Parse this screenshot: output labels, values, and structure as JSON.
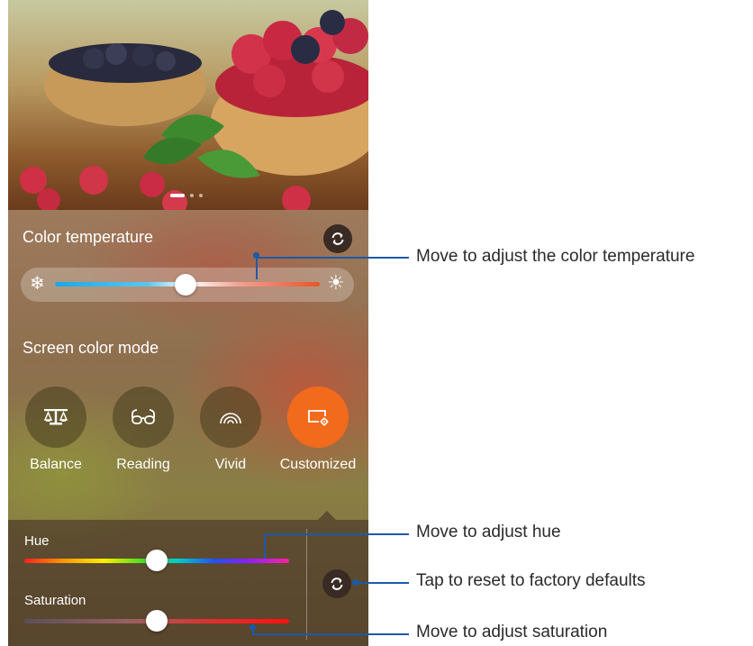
{
  "color_temperature": {
    "title": "Color temperature",
    "reset_icon": "refresh-icon",
    "cold_icon": "snowflake-icon",
    "warm_icon": "sun-icon",
    "value_fraction": 0.5
  },
  "screen_color_mode": {
    "title": "Screen color mode",
    "modes": [
      {
        "label": "Balance",
        "icon": "balance-icon",
        "selected": false
      },
      {
        "label": "Reading",
        "icon": "glasses-icon",
        "selected": false
      },
      {
        "label": "Vivid",
        "icon": "vivid-icon",
        "selected": false
      },
      {
        "label": "Customized",
        "icon": "customized-icon",
        "selected": true
      }
    ],
    "selected_color": "#f26a1b"
  },
  "custom": {
    "hue_label": "Hue",
    "hue_fraction": 0.5,
    "saturation_label": "Saturation",
    "saturation_fraction": 0.5,
    "reset_icon": "refresh-icon"
  },
  "callouts": {
    "temperature": "Move to adjust the color temperature",
    "hue": "Move to adjust hue",
    "reset": "Tap to reset to factory defaults",
    "saturation": "Move to adjust saturation",
    "color": "#1b5aa8"
  },
  "pager": {
    "pages": 3,
    "current": 1
  }
}
